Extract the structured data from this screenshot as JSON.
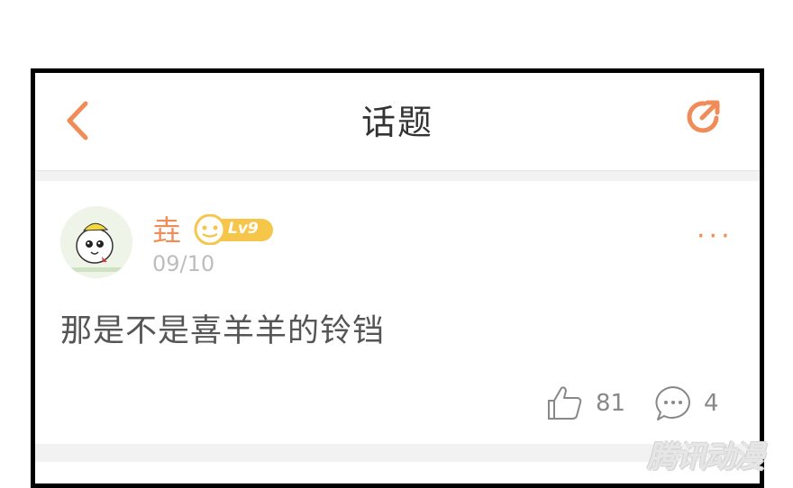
{
  "header": {
    "title": "话题",
    "back_icon": "chevron-left-icon",
    "share_icon": "share-icon"
  },
  "post": {
    "username": "垚",
    "level": "Lv9",
    "date": "09/10",
    "content": "那是不是喜羊羊的铃铛",
    "likes": "81",
    "comments": "4",
    "more_label": "···"
  },
  "watermark": "腾讯动漫",
  "colors": {
    "accent": "#f08c57",
    "badge": "#f5c64a",
    "text": "#555555",
    "muted": "#bdbdbd"
  }
}
